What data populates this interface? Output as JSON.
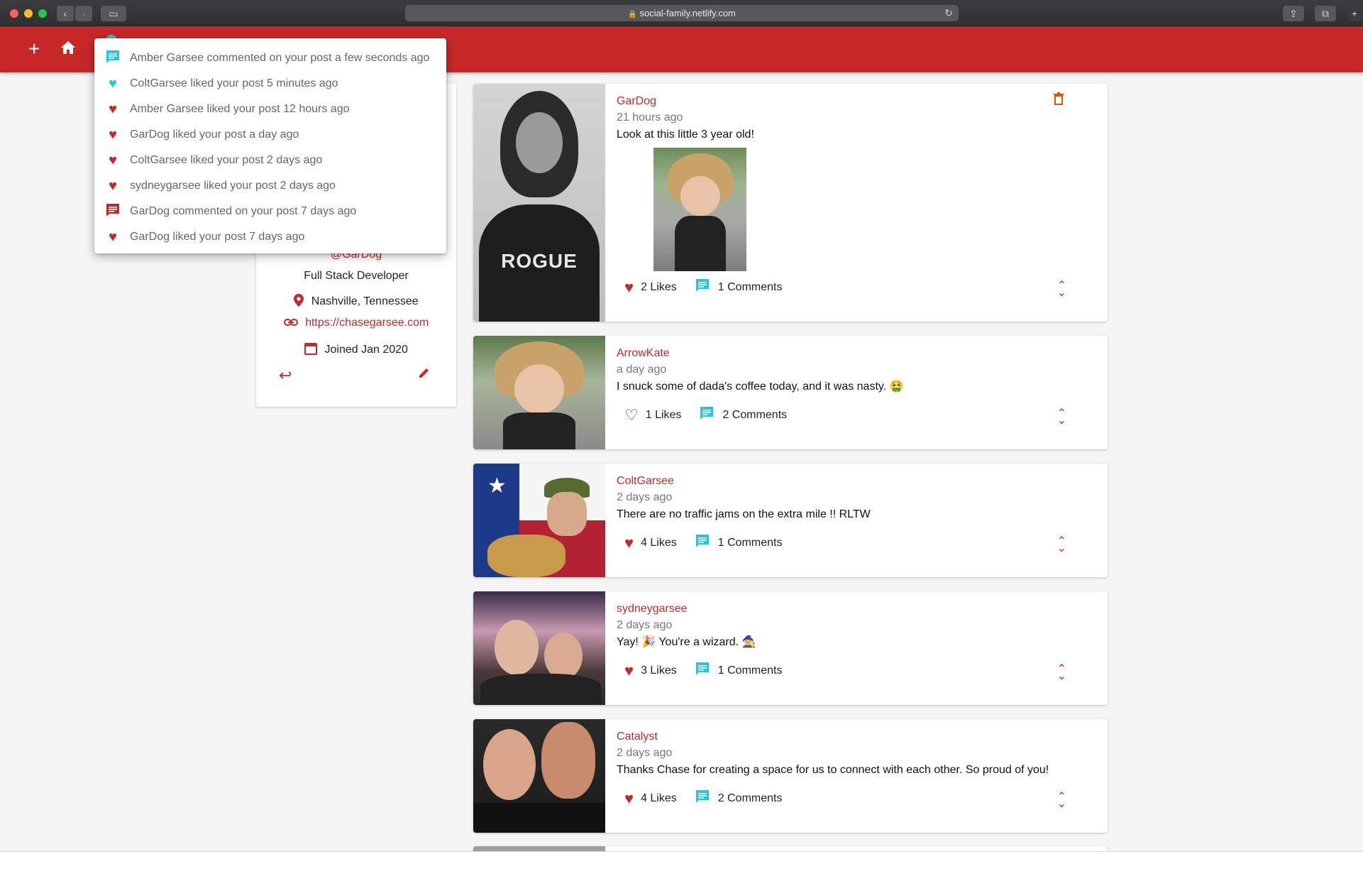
{
  "browser": {
    "url": "social-family.netlify.com",
    "colors": {
      "close": "#ff5f57",
      "minimize": "#febc2e",
      "zoom": "#28c840"
    }
  },
  "appbar": {
    "color": "#c62828",
    "add_icon": "+",
    "home_icon": "home-icon"
  },
  "notifications": [
    {
      "icon": "comment-icon",
      "color": "#26c6da",
      "text": "Amber Garsee commented on your post a few seconds ago"
    },
    {
      "icon": "heart-icon",
      "color": "#26c6da",
      "text": "ColtGarsee liked your post 5 minutes ago"
    },
    {
      "icon": "heart-icon",
      "color": "#c62828",
      "text": "Amber Garsee liked your post 12 hours ago"
    },
    {
      "icon": "heart-icon",
      "color": "#c62828",
      "text": "GarDog liked your post a day ago"
    },
    {
      "icon": "heart-icon",
      "color": "#c62828",
      "text": "ColtGarsee liked your post 2 days ago"
    },
    {
      "icon": "heart-icon",
      "color": "#c62828",
      "text": "sydneygarsee liked your post 2 days ago"
    },
    {
      "icon": "comment-icon",
      "color": "#c62828",
      "text": "GarDog commented on your post 7 days ago"
    },
    {
      "icon": "heart-icon",
      "color": "#c62828",
      "text": "GarDog liked your post 7 days ago"
    }
  ],
  "profile": {
    "handle": "@GarDog",
    "bio": "Full Stack Developer",
    "location": "Nashville, Tennessee",
    "website": "https://chasegarsee.com",
    "joined": "Joined Jan 2020"
  },
  "posts": [
    {
      "user": "GarDog",
      "time": "21 hours ago",
      "text": "Look at this little 3 year old!",
      "likes": "2 Likes",
      "comments": "1 Comments",
      "liked": true
    },
    {
      "user": "ArrowKate",
      "time": "a day ago",
      "text": "I snuck some of dada's coffee today, and it was nasty. 🤮",
      "likes": "1 Likes",
      "comments": "2 Comments",
      "liked": false
    },
    {
      "user": "ColtGarsee",
      "time": "2 days ago",
      "text": "There are no traffic jams on the extra mile !! RLTW",
      "likes": "4 Likes",
      "comments": "1 Comments",
      "liked": true
    },
    {
      "user": "sydneygarsee",
      "time": "2 days ago",
      "text": "Yay! 🎉 You're a wizard. 🧙",
      "likes": "3 Likes",
      "comments": "1 Comments",
      "liked": true
    },
    {
      "user": "Catalyst",
      "time": "2 days ago",
      "text": "Thanks Chase for creating a space for us to connect with each other. So proud of you!",
      "likes": "4 Likes",
      "comments": "2 Comments",
      "liked": true
    }
  ],
  "post_image_text": "ROGUE"
}
